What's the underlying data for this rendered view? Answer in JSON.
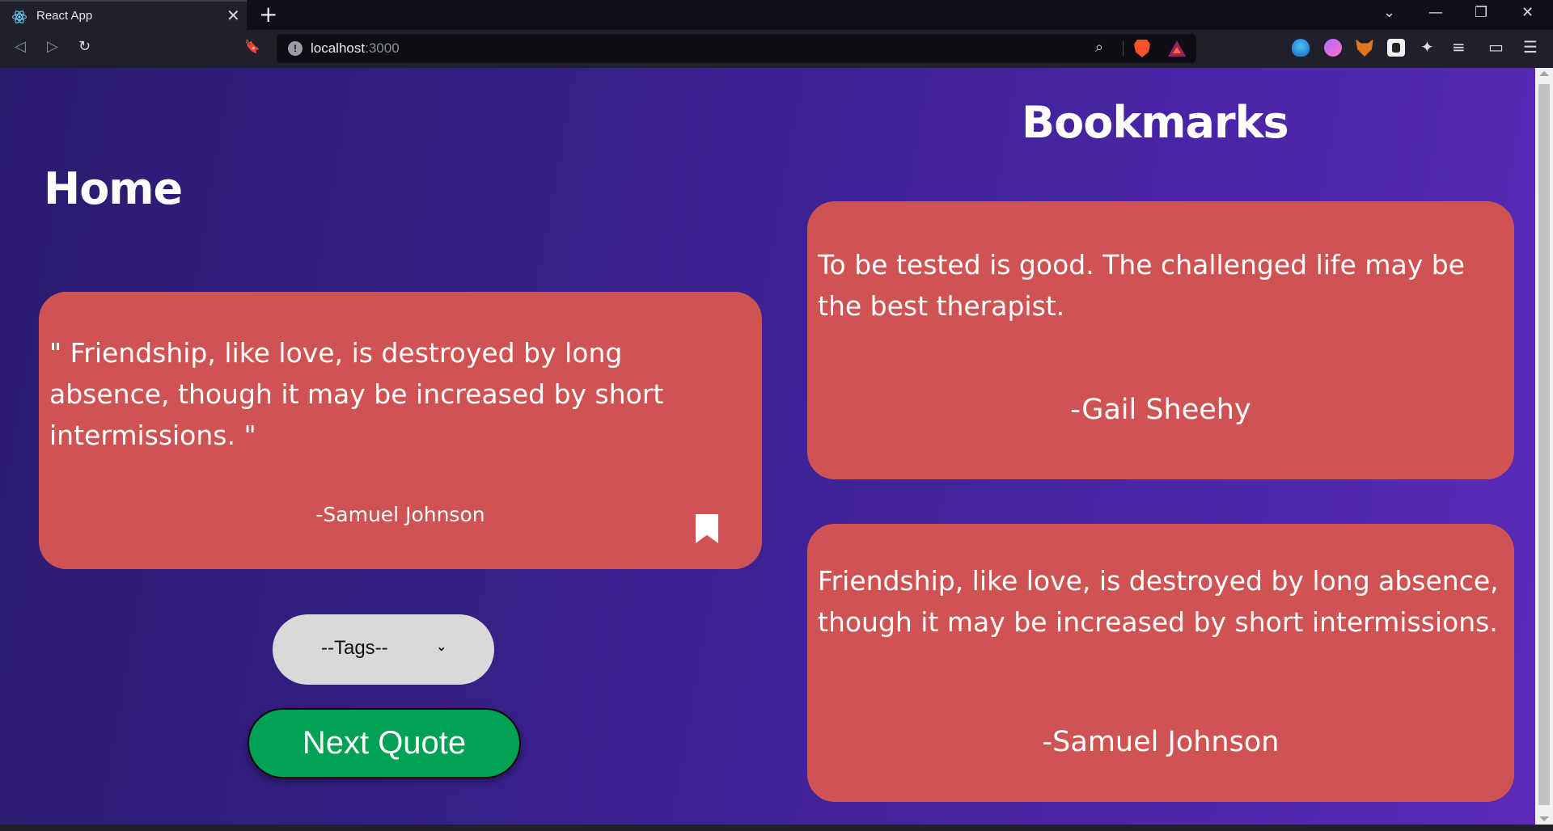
{
  "browser": {
    "tab_title": "React App",
    "tab_close": "✕",
    "new_tab": "+",
    "window_controls": {
      "dropdown": "⌄",
      "minimize": "—",
      "restore": "❐",
      "close": "✕"
    },
    "nav": {
      "back": "◁",
      "forward": "▷",
      "reload": "↻",
      "bookmark": "🔖"
    },
    "url_host": "localhost",
    "url_port": ":3000",
    "icons": [
      "react-favicon-icon",
      "site-info-icon",
      "zoom-icon",
      "brave-shields-icon",
      "brave-rewards-icon",
      "crystal-extension-icon",
      "gradient-extension-icon",
      "metamask-fox-icon",
      "avatar-extension-icon",
      "puzzle-extensions-icon",
      "media-playlist-icon",
      "wallet-icon",
      "menu-icon"
    ],
    "toolbar_glyphs": {
      "extensions": "✦",
      "playlist": "≡",
      "wallet": "▭",
      "menu": "☰"
    }
  },
  "home": {
    "title": "Home",
    "quote": "\" Friendship, like love, is destroyed by long absence, though it may be increased by short intermissions. \"",
    "author": "-Samuel Johnson",
    "tags_select": {
      "selected": "--Tags--"
    },
    "next_button": "Next Quote"
  },
  "bookmarks": {
    "title": "Bookmarks",
    "items": [
      {
        "quote": "To be tested is good. The challenged life may be the best therapist.",
        "author": "-Gail Sheehy"
      },
      {
        "quote": "Friendship, like love, is destroyed by long absence, though it may be increased by short intermissions.",
        "author": "-Samuel Johnson"
      }
    ]
  },
  "colors": {
    "card": "#cf5353",
    "background_start": "#2a1a6e",
    "background_end": "#5b2ab8",
    "next_button": "#00a055",
    "tags_select": "#d9d9d9"
  }
}
